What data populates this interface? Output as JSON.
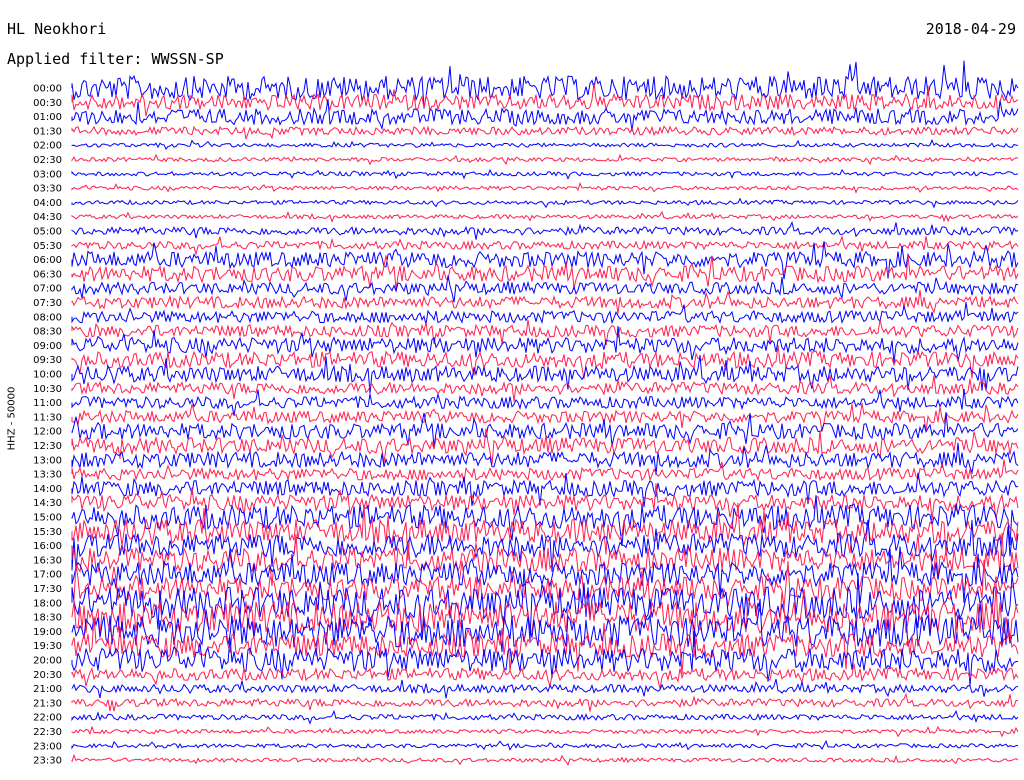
{
  "header": {
    "station": "HL Neokhori",
    "date": "2018-04-29",
    "filter": "Applied filter: WWSSN-SP"
  },
  "chart_data": {
    "type": "line",
    "title": "HL Neokhori",
    "ylabel": "HHZ - 50000",
    "series_colors": [
      "#0000ff",
      "#ff1f4f"
    ],
    "y_tick_labels": [
      "00:00",
      "00:30",
      "01:00",
      "01:30",
      "02:00",
      "02:30",
      "03:00",
      "03:30",
      "04:00",
      "04:30",
      "05:00",
      "05:30",
      "06:00",
      "06:30",
      "07:00",
      "07:30",
      "08:00",
      "08:30",
      "09:00",
      "09:30",
      "10:00",
      "10:30",
      "11:00",
      "11:30",
      "12:00",
      "12:30",
      "13:00",
      "13:30",
      "14:00",
      "14:30",
      "15:00",
      "15:30",
      "16:00",
      "16:30",
      "17:00",
      "17:30",
      "18:00",
      "18:30",
      "19:00",
      "19:30",
      "20:00",
      "20:30",
      "21:00",
      "21:30",
      "22:00",
      "22:30",
      "23:00",
      "23:30"
    ],
    "amplitude": [
      3,
      2,
      2,
      1,
      0.5,
      0.5,
      0.5,
      0.5,
      0.5,
      0.5,
      1,
      1,
      2,
      2,
      1.5,
      1.5,
      1.5,
      1.5,
      2,
      2,
      2,
      1.5,
      1.5,
      1.5,
      2,
      2,
      2,
      1.5,
      2,
      2,
      3,
      3,
      3,
      3,
      3,
      3,
      4,
      4,
      4,
      3,
      3,
      1.5,
      1,
      1,
      0.7,
      0.5,
      0.5,
      0.5
    ]
  }
}
